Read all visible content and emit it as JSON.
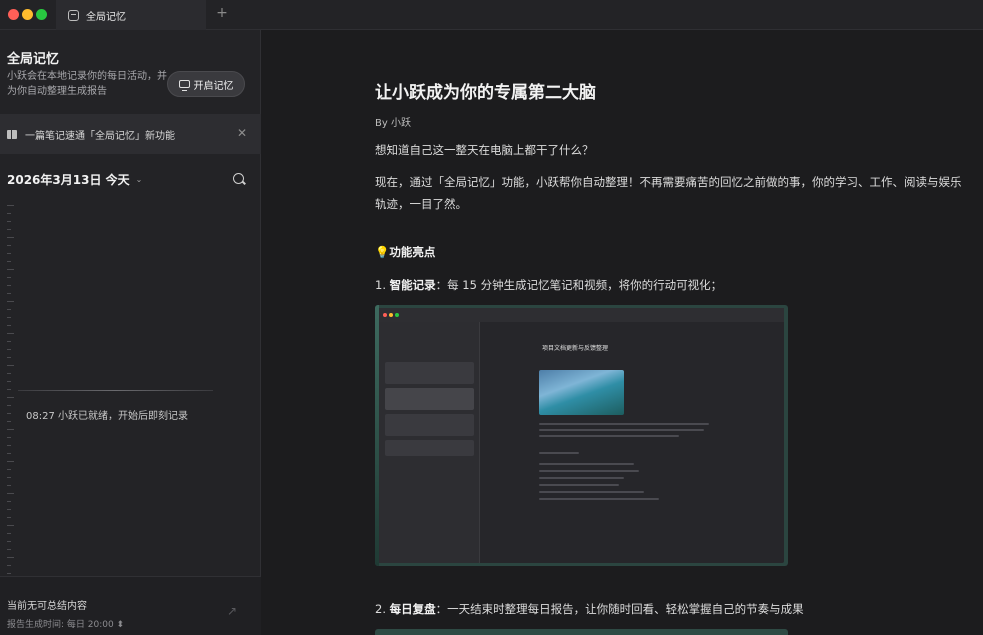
{
  "tab": {
    "label": "全局记忆",
    "add": "+"
  },
  "sidebar": {
    "title": "全局记忆",
    "description": "小跃会在本地记录你的每日活动，并为你自动整理生成报告",
    "open_button": "开启记忆",
    "notice": {
      "text": "一篇笔记速通「全局记忆」新功能",
      "close": "✕"
    },
    "date": "2026年3月13日  今天",
    "chevron": "⌄",
    "ready_message": "08:27 小跃已就绪，开始后即刻记录",
    "footer": {
      "title": "当前无可总结内容",
      "subtitle": "报告生成时间: 每日 20:00 ⬍",
      "arrow": "↗"
    }
  },
  "article": {
    "title": "让小跃成为你的专属第二大脑",
    "byline": "By 小跃",
    "intro": "想知道自己这一整天在电脑上都干了什么？",
    "paragraph": "现在，通过「全局记忆」功能，小跃帮你自动整理！不再需要痛苦的回忆之前做的事，你的学习、工作、阅读与娱乐轨迹，一目了然。",
    "highlights_heading": "💡功能亮点",
    "features": [
      {
        "num": "1. ",
        "name": "智能记录",
        "text": "：每 15 分钟生成记忆笔记和视频，将你的行动可视化；"
      },
      {
        "num": "2. ",
        "name": "每日复盘",
        "text": "：一天结束时整理每日报告，让你随时回看、轻松掌握自己的节奏与成果"
      }
    ],
    "screenshot_title": "项目文档更新与反馈整理"
  },
  "colors": {
    "accent_red": "#fe5f57",
    "accent_yellow": "#febc2e",
    "accent_green": "#28c840",
    "background": "#1c1c1e"
  }
}
